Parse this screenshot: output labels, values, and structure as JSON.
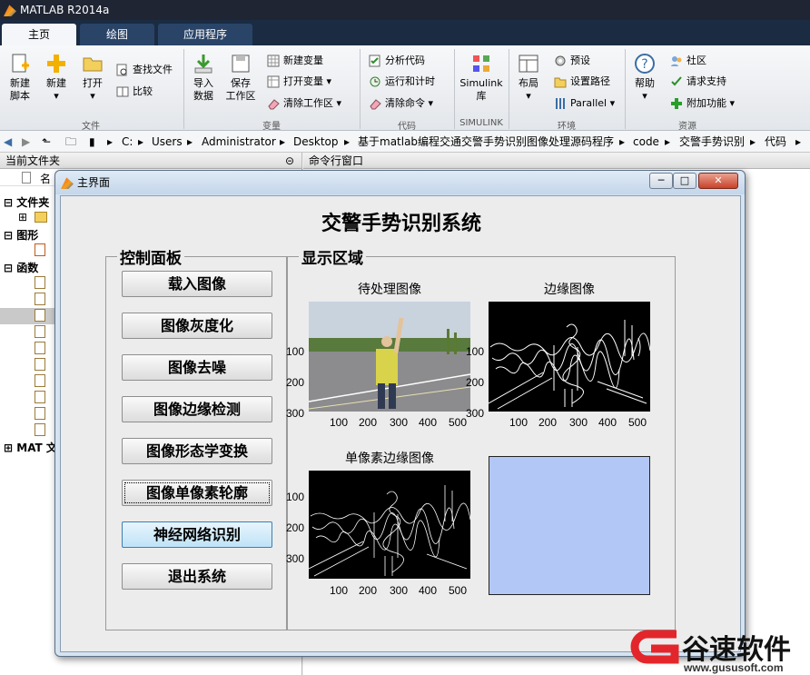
{
  "app": {
    "title": "MATLAB R2014a"
  },
  "tabs": [
    "主页",
    "绘图",
    "应用程序"
  ],
  "ribbon": {
    "file": {
      "label": "文件",
      "new_script": "新建\n脚本",
      "new": "新建",
      "open": "打开",
      "find_files": "查找文件",
      "compare": "比较"
    },
    "variable": {
      "label": "变量",
      "import": "导入\n数据",
      "save_ws": "保存\n工作区",
      "new_var": "新建变量",
      "open_var": "打开变量",
      "clear_ws": "清除工作区"
    },
    "code": {
      "label": "代码",
      "analyze": "分析代码",
      "run_time": "运行和计时",
      "clear_cmd": "清除命令"
    },
    "simulink": {
      "label": "SIMULINK",
      "lib": "Simulink\n库"
    },
    "env": {
      "label": "环境",
      "layout": "布局",
      "prefs": "预设",
      "set_path": "设置路径",
      "parallel": "Parallel"
    },
    "resources": {
      "label": "资源",
      "help": "帮助",
      "community": "社区",
      "support": "请求支持",
      "addons": "附加功能"
    }
  },
  "breadcrumb": [
    "C:",
    "Users",
    "Administrator",
    "Desktop",
    "基于matlab编程交通交警手势识别图像处理源码程序",
    "code",
    "交警手势识别",
    "代码"
  ],
  "left_pane": {
    "title": "当前文件夹",
    "col_name": "名",
    "groups": [
      "文件夹",
      "图形",
      "函数",
      "MAT 文"
    ]
  },
  "cmd_pane": {
    "title": "命令行窗口"
  },
  "window": {
    "title": "主界面",
    "min": "─",
    "max": "□",
    "close": "✕"
  },
  "gui": {
    "title": "交警手势识别系统",
    "control_panel": "控制面板",
    "display_area": "显示区域",
    "buttons": [
      "载入图像",
      "图像灰度化",
      "图像去噪",
      "图像边缘检测",
      "图像形态学变换",
      "图像单像素轮廓",
      "神经网络识别",
      "退出系统"
    ],
    "axes": [
      {
        "title": "待处理图像",
        "yticks": [
          "100",
          "200",
          "300"
        ],
        "xticks": [
          "100",
          "200",
          "300",
          "400",
          "500"
        ]
      },
      {
        "title": "边缘图像",
        "yticks": [
          "100",
          "200",
          "300"
        ],
        "xticks": [
          "100",
          "200",
          "300",
          "400",
          "500"
        ]
      },
      {
        "title": "单像素边缘图像",
        "yticks": [
          "100",
          "200",
          "300"
        ],
        "xticks": [
          "100",
          "200",
          "300",
          "400",
          "500"
        ]
      },
      {
        "title": "",
        "yticks": [],
        "xticks": []
      }
    ]
  },
  "watermark": {
    "brand": "谷速软件",
    "url": "www.gususoft.com"
  },
  "colors": {
    "empty_axes": "#b3c7f7",
    "title_bar": "#1f2533",
    "tab_active": "#f4f6f9"
  }
}
